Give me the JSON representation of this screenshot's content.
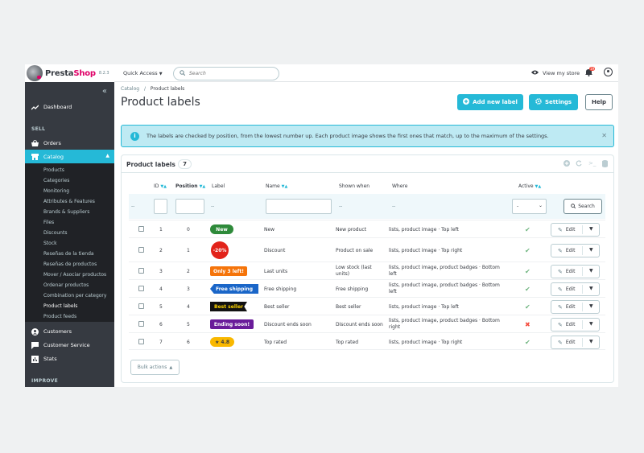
{
  "sidebar": {
    "logo_text": "PrestaShop",
    "logo_presta": "Presta",
    "logo_shop": "Shop",
    "version": "8.2.3",
    "dashboard": "Dashboard",
    "sell_heading": "SELL",
    "orders": "Orders",
    "catalog": "Catalog",
    "catalog_items": [
      "Products",
      "Categories",
      "Monitoring",
      "Attributes & Features",
      "Brands & Suppliers",
      "Files",
      "Discounts",
      "Stock",
      "Reseñas de la tienda",
      "Reseñas de productos",
      "Mover / Asociar productos",
      "Ordenar productos",
      "Combination per category",
      "Product labels",
      "Product feeds"
    ],
    "customers": "Customers",
    "customer_service": "Customer Service",
    "stats": "Stats",
    "improve_heading": "IMPROVE"
  },
  "header": {
    "quick_access": "Quick Access",
    "search_placeholder": "Search",
    "view_store": "View my store",
    "notif_count": "19"
  },
  "toolbar": {
    "breadcrumb_parent": "Catalog",
    "breadcrumb_sep": "/",
    "breadcrumb_current": "Product labels",
    "title": "Product labels",
    "add_label": "Add new label",
    "settings_label": "Settings",
    "help_label": "Help"
  },
  "alert": {
    "text": "The labels are checked by position, from the lowest number up. Each product image shows the first ones that match, up to the maximum of the settings."
  },
  "panel": {
    "title": "Product labels",
    "count": "7",
    "columns": {
      "id": "ID",
      "position": "Position",
      "label": "Label",
      "name": "Name",
      "shown_when": "Shown when",
      "where": "Where",
      "active": "Active"
    },
    "filter_dash": "--",
    "filter_active_value": "-",
    "search_button": "Search",
    "bulk_actions": "Bulk actions",
    "edit_label": "Edit"
  },
  "rows": [
    {
      "id": "1",
      "position": "0",
      "badge": "New",
      "badge_color": "#2e8a3a",
      "name": "New",
      "shown_when": "New product",
      "where": "lists, product image · Top left",
      "active": true
    },
    {
      "id": "2",
      "position": "1",
      "badge": "-20%",
      "badge_color": "#e2231a",
      "name": "Discount",
      "shown_when": "Product on sale",
      "where": "lists, product image · Top right",
      "active": true
    },
    {
      "id": "3",
      "position": "2",
      "badge": "Only 3 left!",
      "badge_color": "#f5740a",
      "name": "Last units",
      "shown_when": "Low stock (last units)",
      "where": "lists, product image, product badges · Bottom left",
      "active": true
    },
    {
      "id": "4",
      "position": "3",
      "badge": "Free shipping",
      "badge_color": "#1a66c8",
      "name": "Free shipping",
      "shown_when": "Free shipping",
      "where": "lists, product image, product badges · Bottom left",
      "active": true
    },
    {
      "id": "5",
      "position": "4",
      "badge": "Best seller",
      "badge_color": "#111111",
      "name": "Best seller",
      "shown_when": "Best seller",
      "where": "lists, product image · Top left",
      "active": true
    },
    {
      "id": "6",
      "position": "5",
      "badge": "Ending soon!",
      "badge_color": "#6a1b9a",
      "name": "Discount ends soon",
      "shown_when": "Discount ends soon",
      "where": "lists, product image, product badges · Bottom right",
      "active": false
    },
    {
      "id": "7",
      "position": "6",
      "badge": "★ 4.8",
      "badge_color": "#f9b800",
      "name": "Top rated",
      "shown_when": "Top rated",
      "where": "lists, product image · Top right",
      "active": true
    }
  ],
  "colors": {
    "accent": "#25b9d7",
    "sidebar": "#363a41",
    "success": "#70b580",
    "danger": "#f54c3e"
  }
}
